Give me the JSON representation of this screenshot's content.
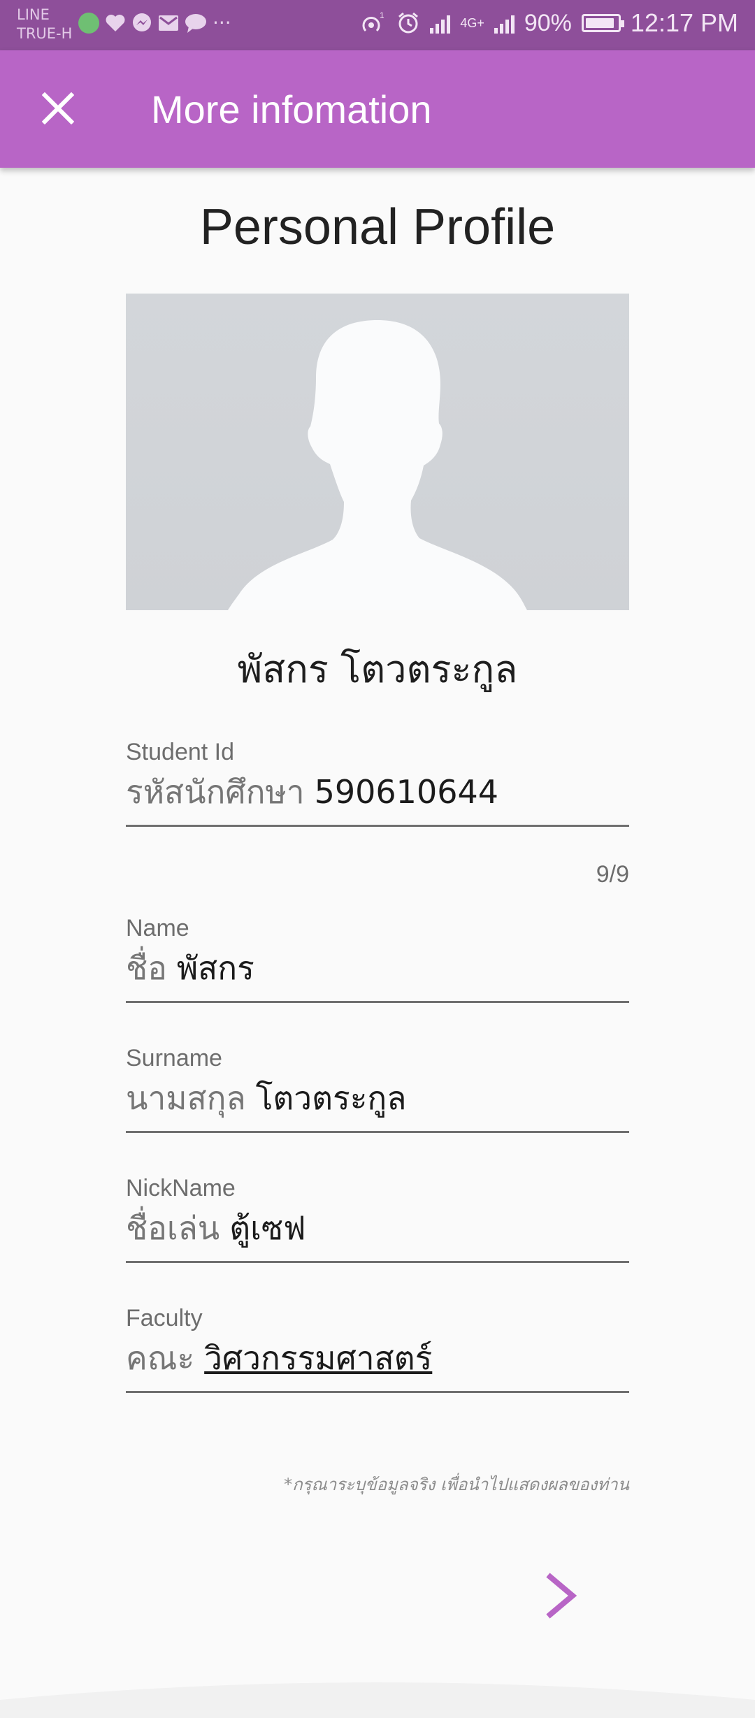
{
  "status_bar": {
    "carrier_line1": "LINE",
    "carrier_line2": "TRUE-H",
    "overflow": "···",
    "network": "4G+",
    "battery": "90%",
    "battery_level": 0.9,
    "time": "12:17 PM",
    "icons": [
      "globe-icon",
      "health-icon",
      "messenger-icon",
      "mail-icon",
      "chat-icon",
      "hotspot-icon",
      "alarm-icon",
      "signal-icon",
      "battery-icon"
    ]
  },
  "app_bar": {
    "title": "More infomation",
    "close_icon": "close-icon"
  },
  "profile": {
    "heading": "Personal Profile",
    "avatar_icon": "person-silhouette-icon",
    "full_name": "พัสกร โตวตระกูล"
  },
  "form": {
    "student_id": {
      "label": "Student Id",
      "prefix": "รหัสนักศึกษา",
      "value": "590610644",
      "counter": "9/9"
    },
    "name": {
      "label": "Name",
      "prefix": "ชื่อ",
      "value": "พัสกร"
    },
    "surname": {
      "label": "Surname",
      "prefix": "นามสกุล",
      "value": "โตวตระกูล"
    },
    "nickname": {
      "label": "NickName",
      "prefix": "ชื่อเล่น",
      "value": "ตู้เซฟ"
    },
    "faculty": {
      "label": "Faculty",
      "prefix": "คณะ",
      "value": "วิศวกรรมศาสตร์"
    }
  },
  "note": "*กรุณาระบุข้อมูลจริง เพื่อนำไปแสดงผลของท่าน",
  "next_icon": "chevron-right-icon",
  "colors": {
    "status_bar": "#8e4f9a",
    "app_bar": "#b865c6",
    "accent": "#b865c6",
    "background": "#fafafa"
  }
}
